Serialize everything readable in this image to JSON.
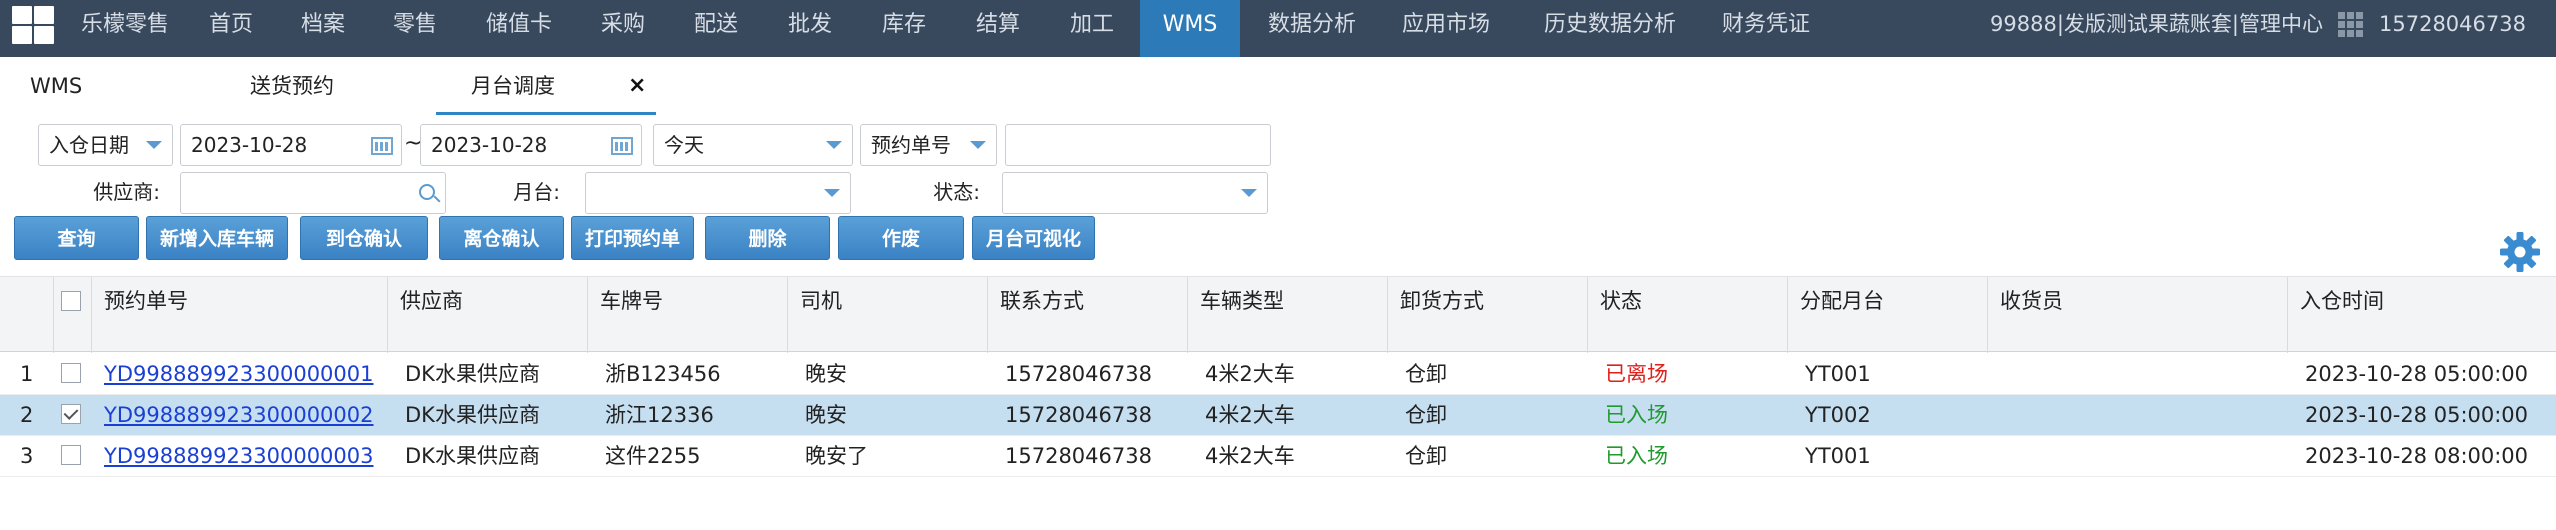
{
  "nav": {
    "items": [
      "乐檬零售",
      "首页",
      "档案",
      "零售",
      "储值卡",
      "采购",
      "配送",
      "批发",
      "库存",
      "结算",
      "加工",
      "WMS",
      "数据分析",
      "应用市场",
      "历史数据分析",
      "财务凭证"
    ],
    "active_index": 11,
    "account_info": "99888|发版测试果蔬账套|管理中心",
    "user_phone": "15728046738"
  },
  "tabs": {
    "items": [
      "WMS",
      "送货预约",
      "月台调度"
    ],
    "active_index": 2,
    "close_symbol": "×"
  },
  "filters": {
    "date_type": "入仓日期",
    "date_from": "2023-10-28",
    "range_separator": "~",
    "date_to": "2023-10-28",
    "date_preset": "今天",
    "search_type": "预约单号",
    "search_value": "",
    "supplier_label": "供应商:",
    "supplier_value": "",
    "dock_label": "月台:",
    "dock_value": "",
    "status_label": "状态:",
    "status_value": ""
  },
  "buttons": [
    "查询",
    "新增入库车辆",
    "到仓确认",
    "离仓确认",
    "打印预约单",
    "删除",
    "作废",
    "月台可视化"
  ],
  "table": {
    "columns": [
      "预约单号",
      "供应商",
      "车牌号",
      "司机",
      "联系方式",
      "车辆类型",
      "卸货方式",
      "状态",
      "分配月台",
      "收货员",
      "入仓时间"
    ],
    "rows": [
      {
        "num": "1",
        "checked": false,
        "selected": false,
        "order_no": "YD998889923300000001",
        "supplier": "DK水果供应商",
        "plate": "浙B123456",
        "driver": "晚安",
        "phone": "15728046738",
        "vehicle_type": "4米2大车",
        "unload": "仓卸",
        "status": "已离场",
        "status_color": "#e0201a",
        "dock": "YT001",
        "receiver": "",
        "arrival_time": "2023-10-28 05:00:00"
      },
      {
        "num": "2",
        "checked": true,
        "selected": true,
        "order_no": "YD998889923300000002",
        "supplier": "DK水果供应商",
        "plate": "浙江12336",
        "driver": "晚安",
        "phone": "15728046738",
        "vehicle_type": "4米2大车",
        "unload": "仓卸",
        "status": "已入场",
        "status_color": "#1f9a2d",
        "dock": "YT002",
        "receiver": "",
        "arrival_time": "2023-10-28 05:00:00"
      },
      {
        "num": "3",
        "checked": false,
        "selected": false,
        "order_no": "YD998889923300000003",
        "supplier": "DK水果供应商",
        "plate": "这件2255",
        "driver": "晚安了",
        "phone": "15728046738",
        "vehicle_type": "4米2大车",
        "unload": "仓卸",
        "status": "已入场",
        "status_color": "#1f9a2d",
        "dock": "YT001",
        "receiver": "",
        "arrival_time": "2023-10-28 08:00:00"
      }
    ]
  }
}
